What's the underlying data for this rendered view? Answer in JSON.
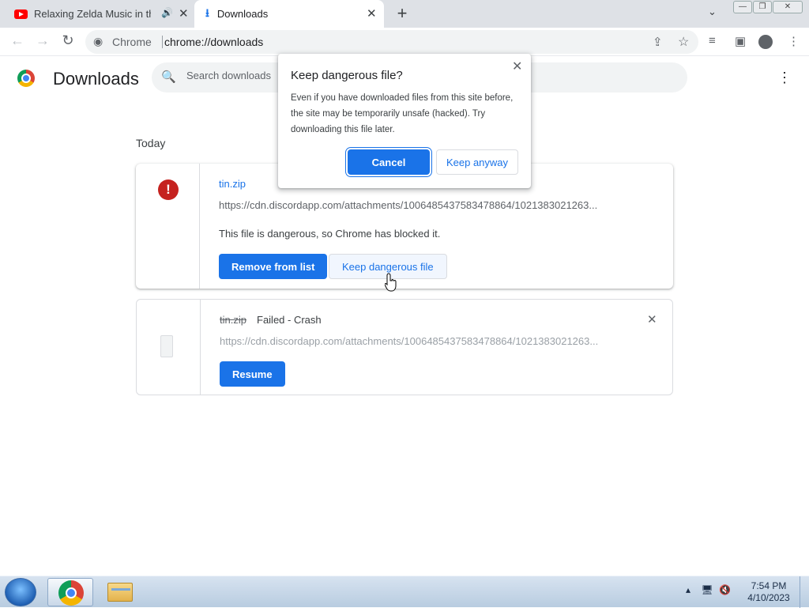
{
  "browser": {
    "tabs": [
      {
        "title": "Relaxing Zelda Music in the R",
        "icon": "youtube-icon",
        "audio_icon": "speaker-icon"
      },
      {
        "title": "Downloads",
        "icon": "download-icon"
      }
    ],
    "new_tab_symbol": "+",
    "window_controls": [
      "—",
      "❐",
      "✕"
    ],
    "omnibox": {
      "site_label": "Chrome",
      "url": "chrome://downloads"
    }
  },
  "page": {
    "title": "Downloads",
    "search_placeholder": "Search downloads",
    "section_label": "Today",
    "downloads": [
      {
        "filename": "tin.zip",
        "url": "https://cdn.discordapp.com/attachments/1006485437583478864/1021383021263...",
        "status_text": "This file is dangerous, so Chrome has blocked it.",
        "primary_action": "Remove from list",
        "secondary_action": "Keep dangerous file",
        "icon": "error-icon"
      },
      {
        "filename": "tin.zip",
        "status": "Failed - Crash",
        "url": "https://cdn.discordapp.com/attachments/1006485437583478864/1021383021263...",
        "primary_action": "Resume",
        "icon": "file-icon"
      }
    ]
  },
  "dialog": {
    "title": "Keep dangerous file?",
    "body": "Even if you have downloaded files from this site before, the site may be temporarily unsafe (hacked). Try downloading this file later.",
    "cancel_label": "Cancel",
    "keep_label": "Keep anyway"
  },
  "taskbar": {
    "time": "7:54 PM",
    "date": "4/10/2023"
  },
  "colors": {
    "accent": "#1a73e8",
    "danger": "#c5221f",
    "tabstrip": "#dee1e6"
  }
}
